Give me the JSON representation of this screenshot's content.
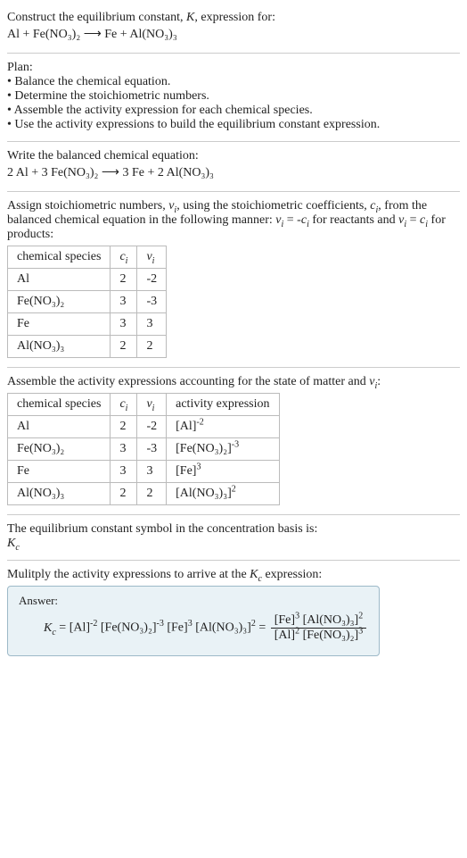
{
  "intro": {
    "line1": "Construct the equilibrium constant, K, expression for:",
    "equation": "Al + Fe(NO₃)₂  ⟶  Fe + Al(NO₃)₃"
  },
  "plan": {
    "heading": "Plan:",
    "b1": "• Balance the chemical equation.",
    "b2": "• Determine the stoichiometric numbers.",
    "b3": "• Assemble the activity expression for each chemical species.",
    "b4": "• Use the activity expressions to build the equilibrium constant expression."
  },
  "balanced": {
    "heading": "Write the balanced chemical equation:",
    "equation": "2 Al + 3 Fe(NO₃)₂  ⟶  3 Fe + 2 Al(NO₃)₃"
  },
  "assign": {
    "text": "Assign stoichiometric numbers, νᵢ, using the stoichiometric coefficients, cᵢ, from the balanced chemical equation in the following manner: νᵢ = -cᵢ for reactants and νᵢ = cᵢ for products:",
    "headers": {
      "h1": "chemical species",
      "h2": "cᵢ",
      "h3": "νᵢ"
    },
    "rows": [
      {
        "sp": "Al",
        "c": "2",
        "v": "-2"
      },
      {
        "sp": "Fe(NO₃)₂",
        "c": "3",
        "v": "-3"
      },
      {
        "sp": "Fe",
        "c": "3",
        "v": "3"
      },
      {
        "sp": "Al(NO₃)₃",
        "c": "2",
        "v": "2"
      }
    ]
  },
  "activities": {
    "text": "Assemble the activity expressions accounting for the state of matter and νᵢ:",
    "headers": {
      "h1": "chemical species",
      "h2": "cᵢ",
      "h3": "νᵢ",
      "h4": "activity expression"
    },
    "rows": [
      {
        "sp": "Al",
        "c": "2",
        "v": "-2",
        "ae_base": "[Al]",
        "ae_exp": "-2"
      },
      {
        "sp": "Fe(NO₃)₂",
        "c": "3",
        "v": "-3",
        "ae_base": "[Fe(NO₃)₂]",
        "ae_exp": "-3"
      },
      {
        "sp": "Fe",
        "c": "3",
        "v": "3",
        "ae_base": "[Fe]",
        "ae_exp": "3"
      },
      {
        "sp": "Al(NO₃)₃",
        "c": "2",
        "v": "2",
        "ae_base": "[Al(NO₃)₃]",
        "ae_exp": "2"
      }
    ]
  },
  "symbol": {
    "line1": "The equilibrium constant symbol in the concentration basis is:",
    "line2": "K𝒸"
  },
  "multiply": {
    "text": "Mulitply the activity expressions to arrive at the K𝒸 expression:"
  },
  "answer": {
    "label": "Answer:",
    "lhs": "K𝒸 = ",
    "flat": {
      "t1": "[Al]",
      "e1": "-2",
      "t2": " [Fe(NO₃)₂]",
      "e2": "-3",
      "t3": " [Fe]",
      "e3": "3",
      "t4": " [Al(NO₃)₃]",
      "e4": "2"
    },
    "eq": " = ",
    "frac": {
      "num": {
        "t1": "[Fe]",
        "e1": "3",
        "t2": " [Al(NO₃)₃]",
        "e2": "2"
      },
      "den": {
        "t1": "[Al]",
        "e1": "2",
        "t2": " [Fe(NO₃)₂]",
        "e2": "3"
      }
    }
  }
}
